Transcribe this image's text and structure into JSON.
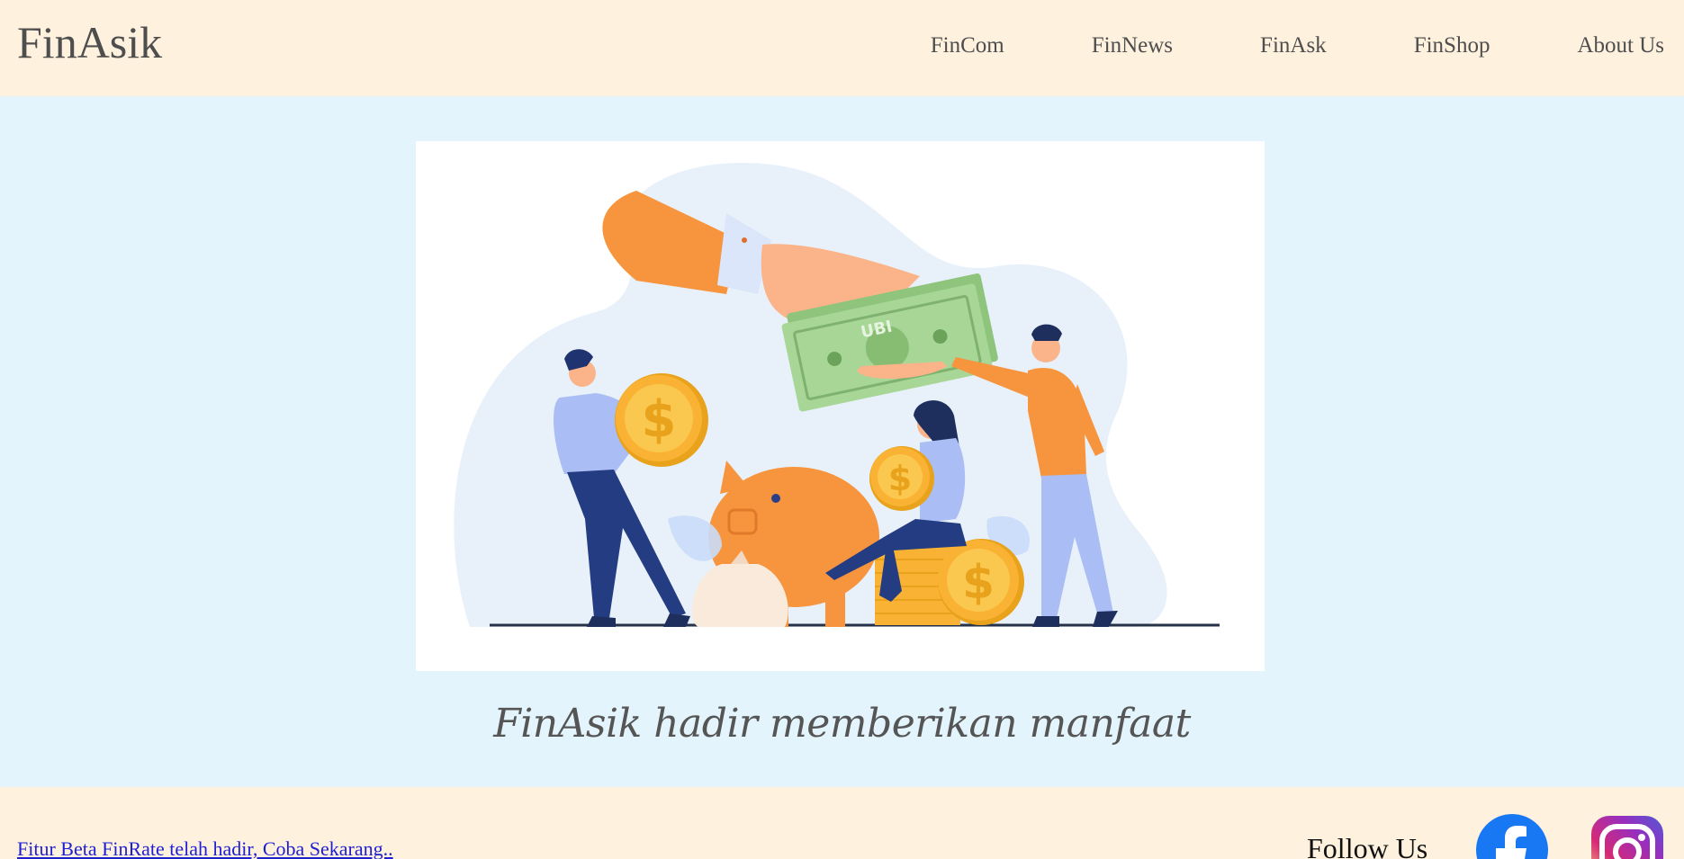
{
  "header": {
    "brand": "FinAsik",
    "nav": [
      "FinCom",
      "FinNews",
      "FinAsk",
      "FinShop",
      "About Us"
    ]
  },
  "hero": {
    "banknote_label": "UBI",
    "tagline": "FinAsik hadir memberikan manfaat"
  },
  "footer": {
    "beta_link": "Fitur Beta FinRate telah hadir, Coba Sekarang..",
    "follow_label": "Follow Us",
    "social": [
      "facebook-icon",
      "instagram-icon"
    ]
  },
  "colors": {
    "header_bg": "#fef1dd",
    "hero_bg": "#e3f4fc",
    "accent_orange": "#f7953f",
    "coin_gold": "#f9b233",
    "note_green": "#9ecf8c",
    "navy": "#2a3f86",
    "lavender": "#aabdf4",
    "link_blue": "#1f1fd2"
  }
}
